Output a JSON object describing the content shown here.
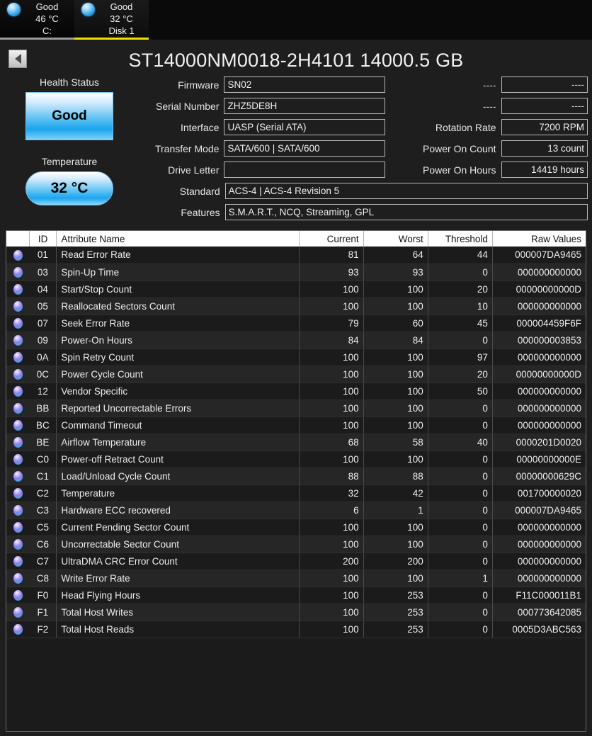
{
  "tabs": [
    {
      "status": "Good",
      "temp": "46 °C",
      "name": "C:",
      "icon": "status-sphere-icon",
      "selected": false
    },
    {
      "status": "Good",
      "temp": "32 °C",
      "name": "Disk 1",
      "icon": "status-sphere-icon",
      "selected": true
    }
  ],
  "header": {
    "back_icon": "back-arrow-icon",
    "drive_title": "ST14000NM0018-2H4101 14000.5 GB"
  },
  "left_panel": {
    "health_label": "Health Status",
    "health_value": "Good",
    "temperature_label": "Temperature",
    "temperature_value": "32 °C"
  },
  "info": {
    "left": [
      {
        "label": "Firmware",
        "value": "SN02"
      },
      {
        "label": "Serial Number",
        "value": "ZHZ5DE8H"
      },
      {
        "label": "Interface",
        "value": "UASP (Serial ATA)"
      },
      {
        "label": "Transfer Mode",
        "value": "SATA/600 | SATA/600"
      },
      {
        "label": "Drive Letter",
        "value": ""
      }
    ],
    "right": [
      {
        "label": "----",
        "value": "----"
      },
      {
        "label": "----",
        "value": "----"
      },
      {
        "label": "Rotation Rate",
        "value": "7200 RPM"
      },
      {
        "label": "Power On Count",
        "value": "13 count"
      },
      {
        "label": "Power On Hours",
        "value": "14419 hours"
      }
    ],
    "wide": [
      {
        "label": "Standard",
        "value": "ACS-4 | ACS-4 Revision 5"
      },
      {
        "label": "Features",
        "value": "S.M.A.R.T., NCQ, Streaming, GPL"
      }
    ]
  },
  "table": {
    "columns": [
      "",
      "ID",
      "Attribute Name",
      "Current",
      "Worst",
      "Threshold",
      "Raw Values"
    ],
    "rows": [
      {
        "icon": "status-sphere-icon",
        "id": "01",
        "name": "Read Error Rate",
        "current": "81",
        "worst": "64",
        "threshold": "44",
        "raw": "000007DA9465"
      },
      {
        "icon": "status-sphere-icon",
        "id": "03",
        "name": "Spin-Up Time",
        "current": "93",
        "worst": "93",
        "threshold": "0",
        "raw": "000000000000"
      },
      {
        "icon": "status-sphere-icon",
        "id": "04",
        "name": "Start/Stop Count",
        "current": "100",
        "worst": "100",
        "threshold": "20",
        "raw": "00000000000D"
      },
      {
        "icon": "status-sphere-icon",
        "id": "05",
        "name": "Reallocated Sectors Count",
        "current": "100",
        "worst": "100",
        "threshold": "10",
        "raw": "000000000000"
      },
      {
        "icon": "status-sphere-icon",
        "id": "07",
        "name": "Seek Error Rate",
        "current": "79",
        "worst": "60",
        "threshold": "45",
        "raw": "000004459F6F"
      },
      {
        "icon": "status-sphere-icon",
        "id": "09",
        "name": "Power-On Hours",
        "current": "84",
        "worst": "84",
        "threshold": "0",
        "raw": "000000003853"
      },
      {
        "icon": "status-sphere-icon",
        "id": "0A",
        "name": "Spin Retry Count",
        "current": "100",
        "worst": "100",
        "threshold": "97",
        "raw": "000000000000"
      },
      {
        "icon": "status-sphere-icon",
        "id": "0C",
        "name": "Power Cycle Count",
        "current": "100",
        "worst": "100",
        "threshold": "20",
        "raw": "00000000000D"
      },
      {
        "icon": "status-sphere-icon",
        "id": "12",
        "name": "Vendor Specific",
        "current": "100",
        "worst": "100",
        "threshold": "50",
        "raw": "000000000000"
      },
      {
        "icon": "status-sphere-icon",
        "id": "BB",
        "name": "Reported Uncorrectable Errors",
        "current": "100",
        "worst": "100",
        "threshold": "0",
        "raw": "000000000000"
      },
      {
        "icon": "status-sphere-icon",
        "id": "BC",
        "name": "Command Timeout",
        "current": "100",
        "worst": "100",
        "threshold": "0",
        "raw": "000000000000"
      },
      {
        "icon": "status-sphere-icon",
        "id": "BE",
        "name": "Airflow Temperature",
        "current": "68",
        "worst": "58",
        "threshold": "40",
        "raw": "0000201D0020"
      },
      {
        "icon": "status-sphere-icon",
        "id": "C0",
        "name": "Power-off Retract Count",
        "current": "100",
        "worst": "100",
        "threshold": "0",
        "raw": "00000000000E"
      },
      {
        "icon": "status-sphere-icon",
        "id": "C1",
        "name": "Load/Unload Cycle Count",
        "current": "88",
        "worst": "88",
        "threshold": "0",
        "raw": "00000000629C"
      },
      {
        "icon": "status-sphere-icon",
        "id": "C2",
        "name": "Temperature",
        "current": "32",
        "worst": "42",
        "threshold": "0",
        "raw": "001700000020"
      },
      {
        "icon": "status-sphere-icon",
        "id": "C3",
        "name": "Hardware ECC recovered",
        "current": "6",
        "worst": "1",
        "threshold": "0",
        "raw": "000007DA9465"
      },
      {
        "icon": "status-sphere-icon",
        "id": "C5",
        "name": "Current Pending Sector Count",
        "current": "100",
        "worst": "100",
        "threshold": "0",
        "raw": "000000000000"
      },
      {
        "icon": "status-sphere-icon",
        "id": "C6",
        "name": "Uncorrectable Sector Count",
        "current": "100",
        "worst": "100",
        "threshold": "0",
        "raw": "000000000000"
      },
      {
        "icon": "status-sphere-icon",
        "id": "C7",
        "name": "UltraDMA CRC Error Count",
        "current": "200",
        "worst": "200",
        "threshold": "0",
        "raw": "000000000000"
      },
      {
        "icon": "status-sphere-icon",
        "id": "C8",
        "name": "Write Error Rate",
        "current": "100",
        "worst": "100",
        "threshold": "1",
        "raw": "000000000000"
      },
      {
        "icon": "status-sphere-icon",
        "id": "F0",
        "name": "Head Flying Hours",
        "current": "100",
        "worst": "253",
        "threshold": "0",
        "raw": "F11C000011B1"
      },
      {
        "icon": "status-sphere-icon",
        "id": "F1",
        "name": "Total Host Writes",
        "current": "100",
        "worst": "253",
        "threshold": "0",
        "raw": "000773642085"
      },
      {
        "icon": "status-sphere-icon",
        "id": "F2",
        "name": "Total Host Reads",
        "current": "100",
        "worst": "253",
        "threshold": "0",
        "raw": "0005D3ABC563"
      }
    ]
  },
  "colors": {
    "background": "#1e1e1e",
    "tabbar_bg": "#0a0a0a",
    "selected_tab_underline": "#ece100",
    "unselected_tab_underline": "#9a9a9a",
    "good_blue": "#1aa5ef",
    "text": "#ececec"
  }
}
